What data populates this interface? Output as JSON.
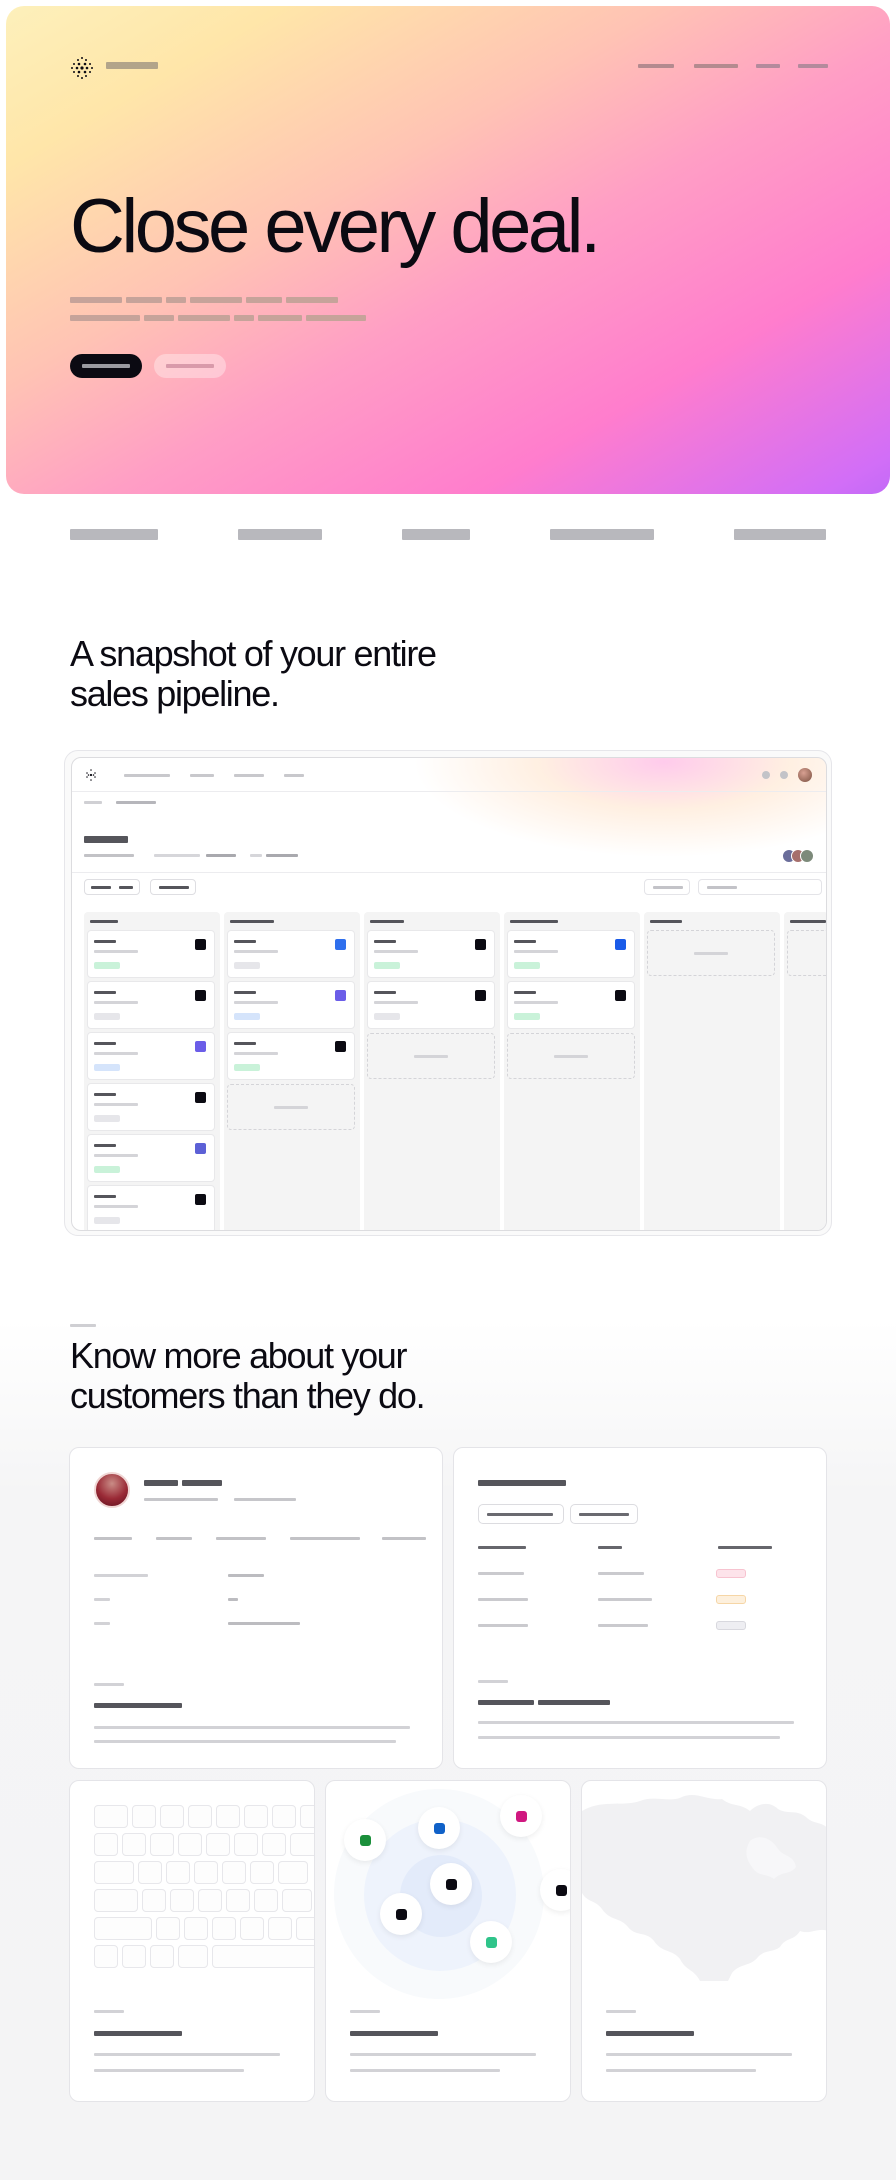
{
  "hero": {
    "title": "Close every deal.",
    "logo_icon": "dotted-sphere-icon",
    "colors": {
      "gradient_start": "#fdf0bb",
      "gradient_mid": "#ff9ec5",
      "gradient_end": "#c36af7",
      "cta": "#0b0a12"
    }
  },
  "pipeline_section": {
    "heading": "A snapshot of your entire\nsales pipeline."
  },
  "customers_section": {
    "heading": "Know more about your\ncustomers than they do."
  },
  "board": {
    "chip_colors": {
      "black": "#0b0a12",
      "blue": "#2f6fed",
      "violet": "#6b5de8",
      "indigo": "#5c60d6",
      "royal": "#1a5be8"
    },
    "badge_colors": {
      "green": "#c9f2d9",
      "gray": "#e6e6ea",
      "blue": "#d5e4fb"
    }
  },
  "relations": {
    "node_colors": [
      "#1a8f3a",
      "#1061c8",
      "#d01880",
      "#0b0a12",
      "#0b0a12",
      "#2fc48a",
      "#0b0a12"
    ]
  }
}
